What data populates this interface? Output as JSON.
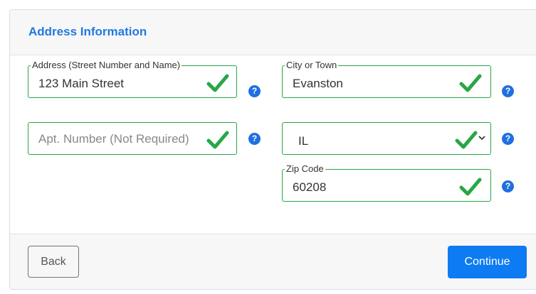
{
  "section": {
    "title": "Address Information"
  },
  "fields": {
    "address": {
      "label": "Address (Street Number and Name)",
      "value": "123 Main Street",
      "valid": true
    },
    "city": {
      "label": "City or Town",
      "value": "Evanston",
      "valid": true
    },
    "apt": {
      "placeholder": "Apt. Number (Not Required)",
      "value": "",
      "valid": true
    },
    "state": {
      "value": "IL",
      "valid": true
    },
    "zip": {
      "label": "Zip Code",
      "value": "60208",
      "valid": true
    }
  },
  "help_glyph": "?",
  "buttons": {
    "back_label": "Back",
    "continue_label": "Continue"
  },
  "colors": {
    "accent": "#1f7ae0",
    "valid": "#28a745",
    "primary_button": "#0d7bf2"
  }
}
